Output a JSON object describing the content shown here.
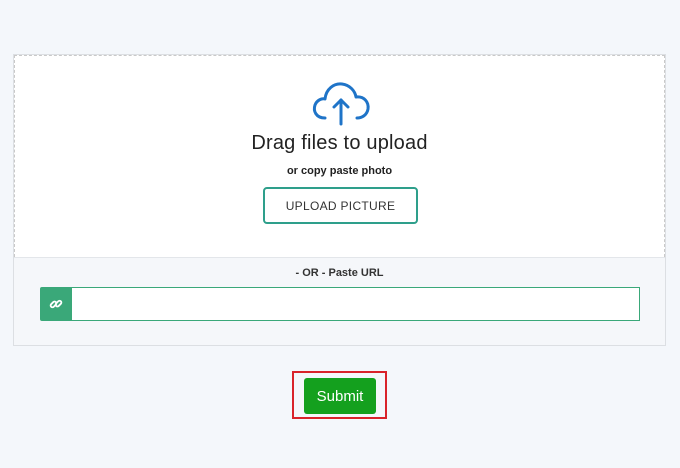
{
  "upload": {
    "icon": "cloud-upload-icon",
    "title": "Drag files to upload",
    "subtitle": "or copy paste photo",
    "button_label": "UPLOAD PICTURE"
  },
  "url": {
    "label": "- OR - Paste URL",
    "icon": "link-icon",
    "value": "",
    "placeholder": ""
  },
  "submit": {
    "label": "Submit"
  },
  "colors": {
    "accent_teal": "#2e9f8b",
    "link_green": "#3aa879",
    "submit_green": "#14a01e",
    "highlight_red": "#d9232b",
    "icon_blue": "#1f74c8"
  }
}
